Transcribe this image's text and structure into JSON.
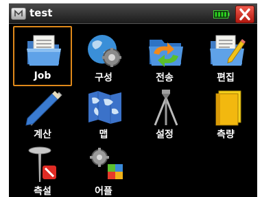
{
  "window": {
    "title": "test",
    "start_icon": "m-logo-icon",
    "battery_icon": "battery-icon",
    "close_icon": "close-icon"
  },
  "apps": [
    {
      "label": "Job",
      "icon": "folder-document-icon",
      "selected": true
    },
    {
      "label": "구성",
      "icon": "globe-gear-icon",
      "selected": false
    },
    {
      "label": "전송",
      "icon": "folder-transfer-icon",
      "selected": false
    },
    {
      "label": "편집",
      "icon": "folder-pencil-icon",
      "selected": false
    },
    {
      "label": "계산",
      "icon": "ruler-pencil-icon",
      "selected": false
    },
    {
      "label": "맵",
      "icon": "world-map-icon",
      "selected": false
    },
    {
      "label": "설정",
      "icon": "tripod-icon",
      "selected": false
    },
    {
      "label": "측량",
      "icon": "notebook-icon",
      "selected": false
    },
    {
      "label": "측설",
      "icon": "stakeout-pin-icon",
      "selected": false
    },
    {
      "label": "어플",
      "icon": "gears-blocks-icon",
      "selected": false
    }
  ],
  "colors": {
    "background": "#000000",
    "selection_border": "#e0891a",
    "close_button": "#d0281a",
    "battery": "#2bd11f"
  }
}
